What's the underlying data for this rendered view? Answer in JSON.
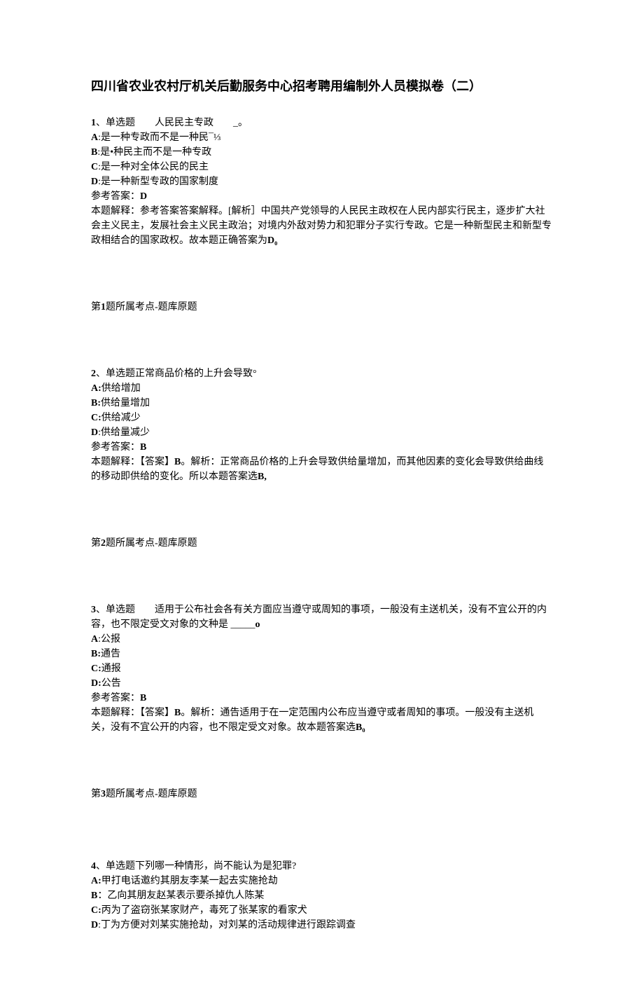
{
  "title": "四川省农业农村厅机关后勤服务中心招考聘用编制外人员模拟卷（二）",
  "q1": {
    "header_prefix": "1",
    "header_rest": "、单选题　　人民民主专政　　_。",
    "optA_prefix": "A",
    "optA_rest": ":是一种专政而不是一种民¯⅓",
    "optB_prefix": "B",
    "optB_rest": ":是•种民主而不是一种专政",
    "optC_prefix": "C",
    "optC_rest": ":是一种对全体公民的民主",
    "optD_prefix": "D",
    "optD_rest": ":是一种新型专政的国家制度",
    "ans_label": "参考答案：",
    "ans_value": "D",
    "expl_line1": "本题解释：参考答案答案解释。[解析］中国共产党领导的人民民主政权在人民内部实行民主，逐步扩大社会主义民主，发展社会主义民主政治；对境内外敌对势力和犯罪分子实行专政。它是一种新型民主和新型专政相结合的国家政权。故本题正确答案为",
    "expl_bold_end": "D₀",
    "kp_prefix": "第",
    "kp_num": "1",
    "kp_rest": "题所属考点-题库原题"
  },
  "q2": {
    "header_prefix": "2",
    "header_rest": "、单选题正常商品价格的上升会导致°",
    "optA_prefix": "A:",
    "optA_rest": "供给增加",
    "optB_prefix": "B:",
    "optB_rest": "供给量增加",
    "optC_prefix": "C:",
    "optC_rest": "供给减少",
    "optD_prefix": "D",
    "optD_rest": ":供给量减少",
    "ans_label": "参考答案：",
    "ans_value": "B",
    "expl_pre": "本题解释：【答案】",
    "expl_mid_bold": "B",
    "expl_post": "。解析：正常商品价格的上升会导致供给量增加，而其他因素的变化会导致供给曲线的移动即供给的变化。所以本题答案选",
    "expl_end_bold": "B,",
    "kp_prefix": "第",
    "kp_num": "2",
    "kp_rest": "题所属考点-题库原题"
  },
  "q3": {
    "header_prefix": "3",
    "header_rest": "、单选题　　适用于公布社会各有关方面应当遵守或周知的事项，一般没有主送机关，没有不宜公开的内容，也不限定受文对象的文种是 _____",
    "header_end_bold": "o",
    "optA_prefix": "A",
    "optA_rest": ":公报",
    "optB_prefix": "B:",
    "optB_rest": "通告",
    "optC_prefix": "C:",
    "optC_rest": "通报",
    "optD_prefix": "D:",
    "optD_rest": "公告",
    "ans_label": "参考答案：",
    "ans_value": "B",
    "expl_pre": "本题解释：【答案】",
    "expl_mid_bold": "B",
    "expl_post": "。解析：通告适用于在一定范围内公布应当遵守或者周知的事项。一般没有主送机关，没有不宜公开的内容，也不限定受文对象。故本题答案选",
    "expl_end_bold": "B₀",
    "kp_prefix": "第",
    "kp_num": "3",
    "kp_rest": "题所属考点-题库原题"
  },
  "q4": {
    "header_prefix": "4",
    "header_rest": "、单选题下列哪一种情形，尚不能认为是犯罪?",
    "optA_prefix": "A:",
    "optA_rest": "甲打电话邀约其朋友李某一起去实施抢劫",
    "optB_prefix": "B",
    "optB_rest": "：乙向其朋友赵某表示要杀掉仇人陈某",
    "optC_prefix": "C:",
    "optC_rest": "丙为了盗窃张某家财产，毒死了张某家的看家犬",
    "optD_prefix": "D",
    "optD_rest": ":丁为方便对刘某实施抢劫，对刘某的活动规律进行跟踪调查"
  }
}
